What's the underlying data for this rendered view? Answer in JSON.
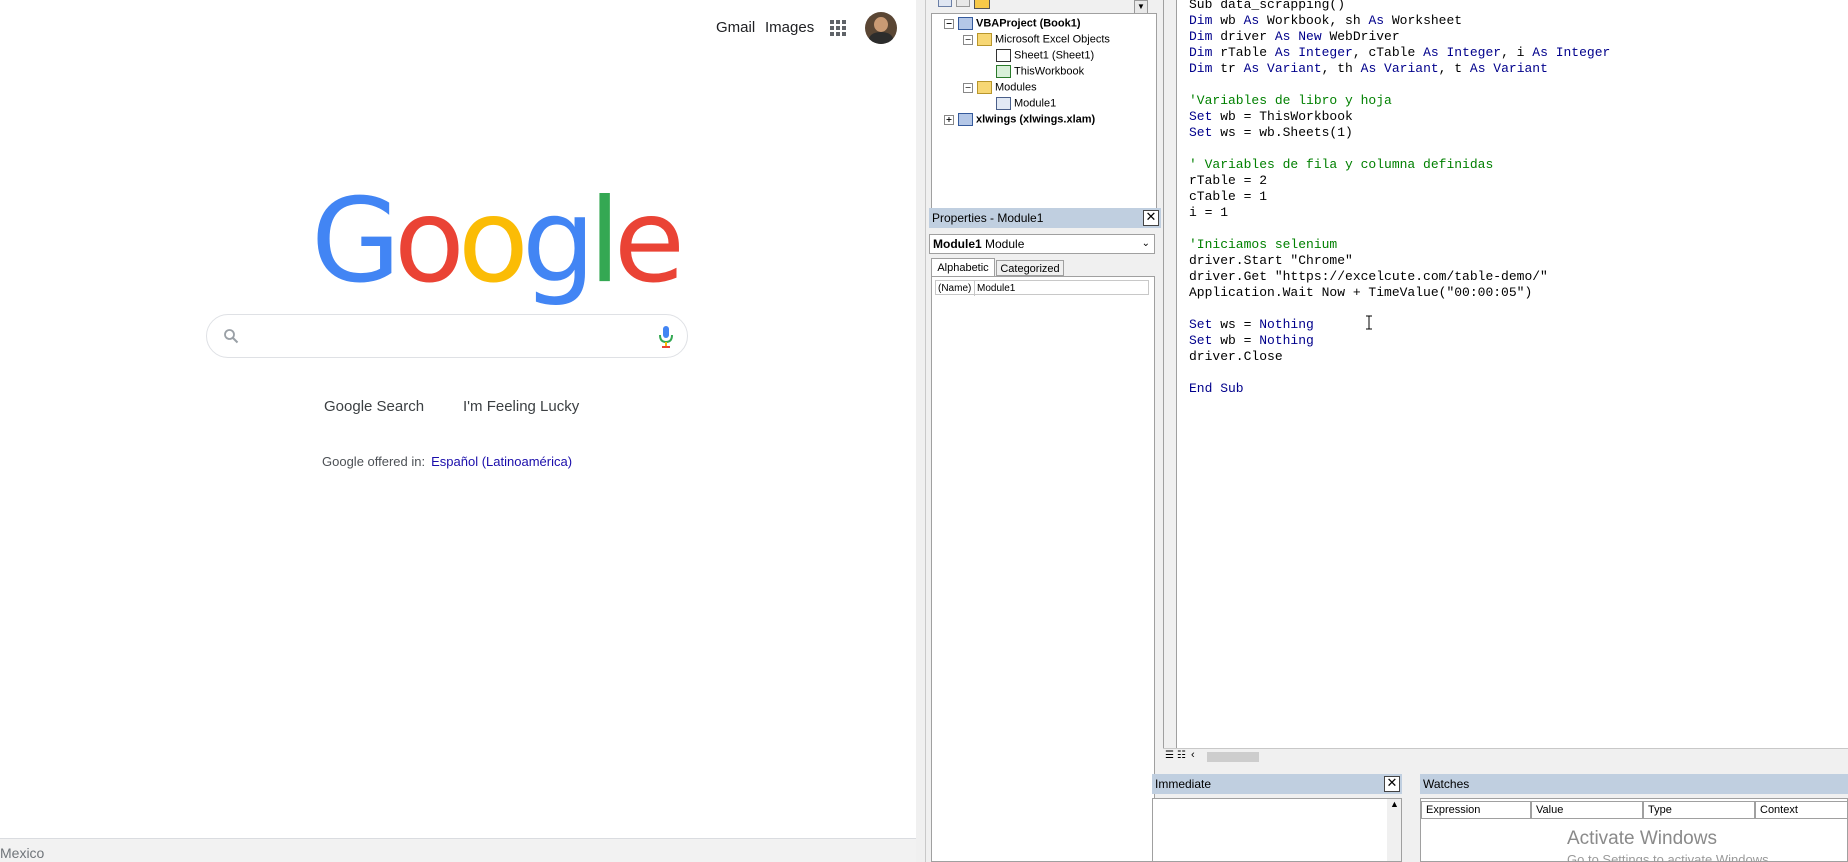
{
  "google": {
    "gmail_label": "Gmail",
    "images_label": "Images",
    "logo_letters": [
      "G",
      "o",
      "o",
      "g",
      "l",
      "e"
    ],
    "logo_colors": [
      "#4285f4",
      "#ea4335",
      "#fbbc05",
      "#4285f4",
      "#34a853",
      "#ea4335"
    ],
    "search_input": {
      "value": "",
      "placeholder": ""
    },
    "search_button": "Google Search",
    "lucky_button": "I'm Feeling Lucky",
    "offered_prefix": "Google offered in:",
    "offered_language": "Español (Latinoamérica)",
    "footer_country": "Mexico"
  },
  "vbe": {
    "project_tree": {
      "project": "VBAProject (Book1)",
      "excel_objects": "Microsoft Excel Objects",
      "sheet1": "Sheet1 (Sheet1)",
      "thisworkbook": "ThisWorkbook",
      "modules": "Modules",
      "module1": "Module1",
      "xlwings": "xlwings (xlwings.xlam)"
    },
    "properties": {
      "title": "Properties - Module1",
      "object_name": "Module1",
      "object_type": "Module",
      "tab_alphabetic": "Alphabetic",
      "tab_categorized": "Categorized",
      "prop_name": "(Name)",
      "prop_value": "Module1"
    },
    "code_lines": [
      {
        "parts": [
          {
            "t": "Sub data_scrapping()",
            "k": "n"
          }
        ]
      },
      {
        "parts": [
          {
            "t": "Dim",
            "k": "kw"
          },
          {
            "t": " wb ",
            "k": "n"
          },
          {
            "t": "As",
            "k": "kw"
          },
          {
            "t": " Workbook, sh ",
            "k": "n"
          },
          {
            "t": "As",
            "k": "kw"
          },
          {
            "t": " Worksheet",
            "k": "n"
          }
        ]
      },
      {
        "parts": [
          {
            "t": "Dim",
            "k": "kw"
          },
          {
            "t": " driver ",
            "k": "n"
          },
          {
            "t": "As New",
            "k": "kw"
          },
          {
            "t": " WebDriver",
            "k": "n"
          }
        ]
      },
      {
        "parts": [
          {
            "t": "Dim",
            "k": "kw"
          },
          {
            "t": " rTable ",
            "k": "n"
          },
          {
            "t": "As Integer",
            "k": "kw"
          },
          {
            "t": ", cTable ",
            "k": "n"
          },
          {
            "t": "As Integer",
            "k": "kw"
          },
          {
            "t": ", i ",
            "k": "n"
          },
          {
            "t": "As Integer",
            "k": "kw"
          }
        ]
      },
      {
        "parts": [
          {
            "t": "Dim",
            "k": "kw"
          },
          {
            "t": " tr ",
            "k": "n"
          },
          {
            "t": "As Variant",
            "k": "kw"
          },
          {
            "t": ", th ",
            "k": "n"
          },
          {
            "t": "As Variant",
            "k": "kw"
          },
          {
            "t": ", t ",
            "k": "n"
          },
          {
            "t": "As Variant",
            "k": "kw"
          }
        ]
      },
      {
        "parts": []
      },
      {
        "parts": [
          {
            "t": "'Variables de libro y hoja",
            "k": "cm"
          }
        ]
      },
      {
        "parts": [
          {
            "t": "Set",
            "k": "kw"
          },
          {
            "t": " wb = ThisWorkbook",
            "k": "n"
          }
        ]
      },
      {
        "parts": [
          {
            "t": "Set",
            "k": "kw"
          },
          {
            "t": " ws = wb.Sheets(1)",
            "k": "n"
          }
        ]
      },
      {
        "parts": []
      },
      {
        "parts": [
          {
            "t": "' Variables de fila y columna definidas",
            "k": "cm"
          }
        ]
      },
      {
        "parts": [
          {
            "t": "rTable = 2",
            "k": "n"
          }
        ]
      },
      {
        "parts": [
          {
            "t": "cTable = 1",
            "k": "n"
          }
        ]
      },
      {
        "parts": [
          {
            "t": "i = 1",
            "k": "n"
          }
        ]
      },
      {
        "parts": []
      },
      {
        "parts": [
          {
            "t": "'Iniciamos selenium",
            "k": "cm"
          }
        ]
      },
      {
        "parts": [
          {
            "t": "driver.Start \"Chrome\"",
            "k": "n"
          }
        ]
      },
      {
        "parts": [
          {
            "t": "driver.Get \"https://excelcute.com/table-demo/\"",
            "k": "n"
          }
        ]
      },
      {
        "parts": [
          {
            "t": "Application.Wait Now + TimeValue(\"00:00:05\")",
            "k": "n"
          }
        ]
      },
      {
        "parts": []
      },
      {
        "parts": [
          {
            "t": "Set",
            "k": "kw"
          },
          {
            "t": " ws = ",
            "k": "n"
          },
          {
            "t": "Nothing",
            "k": "kw"
          }
        ]
      },
      {
        "parts": [
          {
            "t": "Set",
            "k": "kw"
          },
          {
            "t": " wb = ",
            "k": "n"
          },
          {
            "t": "Nothing",
            "k": "kw"
          }
        ]
      },
      {
        "parts": [
          {
            "t": "driver.Close",
            "k": "n"
          }
        ]
      },
      {
        "parts": []
      },
      {
        "parts": [
          {
            "t": "End Sub",
            "k": "kw"
          }
        ]
      }
    ],
    "immediate_title": "Immediate",
    "watches": {
      "title": "Watches",
      "columns": [
        "Expression",
        "Value",
        "Type",
        "Context"
      ]
    },
    "activate_windows": "Activate Windows",
    "activate_windows_sub": "Go to Settings to activate Windows."
  }
}
